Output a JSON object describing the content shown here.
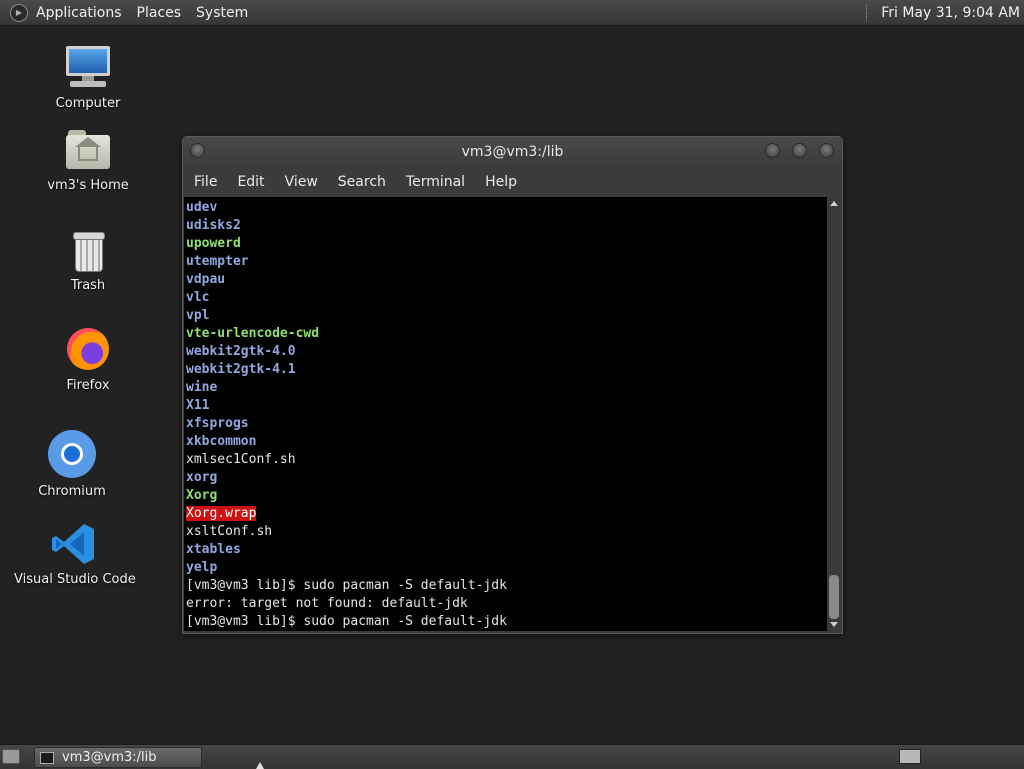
{
  "top_panel": {
    "menus": [
      "Applications",
      "Places",
      "System"
    ],
    "clock": "Fri May 31,  9:04 AM"
  },
  "desktop": {
    "icons": [
      {
        "label": "Computer",
        "icon": "computer-icon"
      },
      {
        "label": "vm3's Home",
        "icon": "home-folder-icon"
      },
      {
        "label": "Trash",
        "icon": "trash-icon"
      },
      {
        "label": "Firefox",
        "icon": "firefox-icon"
      },
      {
        "label": "Chromium",
        "icon": "chromium-icon"
      },
      {
        "label": "Visual Studio Code",
        "icon": "vscode-icon"
      }
    ]
  },
  "terminal": {
    "title": "vm3@vm3:/lib",
    "menus": [
      "File",
      "Edit",
      "View",
      "Search",
      "Terminal",
      "Help"
    ],
    "lines": [
      {
        "text": "udev",
        "kind": "dir"
      },
      {
        "text": "udisks2",
        "kind": "dir"
      },
      {
        "text": "upowerd",
        "kind": "exec"
      },
      {
        "text": "utempter",
        "kind": "dir"
      },
      {
        "text": "vdpau",
        "kind": "dir"
      },
      {
        "text": "vlc",
        "kind": "dir"
      },
      {
        "text": "vpl",
        "kind": "dir"
      },
      {
        "text": "vte-urlencode-cwd",
        "kind": "exec"
      },
      {
        "text": "webkit2gtk-4.0",
        "kind": "dir"
      },
      {
        "text": "webkit2gtk-4.1",
        "kind": "dir"
      },
      {
        "text": "wine",
        "kind": "dir"
      },
      {
        "text": "X11",
        "kind": "dir"
      },
      {
        "text": "xfsprogs",
        "kind": "dir"
      },
      {
        "text": "xkbcommon",
        "kind": "dir"
      },
      {
        "text": "xmlsec1Conf.sh",
        "kind": "file"
      },
      {
        "text": "xorg",
        "kind": "dir"
      },
      {
        "text": "Xorg",
        "kind": "exec"
      },
      {
        "text": "Xorg.wrap",
        "kind": "hl"
      },
      {
        "text": "xsltConf.sh",
        "kind": "file"
      },
      {
        "text": "xtables",
        "kind": "dir"
      },
      {
        "text": "yelp",
        "kind": "dir"
      },
      {
        "text": "[vm3@vm3 lib]$ sudo pacman -S default-jdk",
        "kind": "file"
      },
      {
        "text": "error: target not found: default-jdk",
        "kind": "file"
      },
      {
        "text": "[vm3@vm3 lib]$ sudo pacman -S default-jdk",
        "kind": "file"
      }
    ]
  },
  "taskbar": {
    "window_label": "vm3@vm3:/lib"
  }
}
